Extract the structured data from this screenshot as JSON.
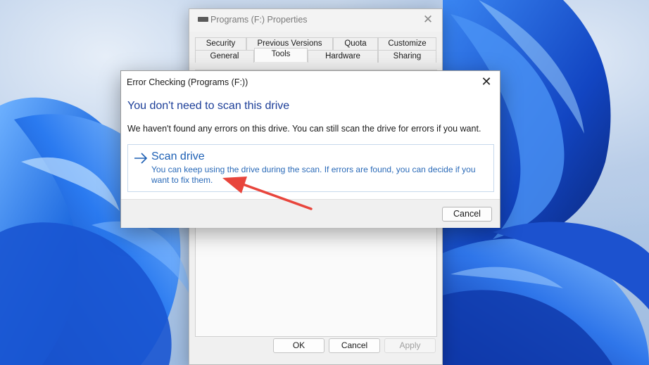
{
  "properties_window": {
    "title": "Programs (F:) Properties",
    "close_glyph": "✕",
    "tabs_row1": [
      "Security",
      "Previous Versions",
      "Quota",
      "Customize"
    ],
    "tabs_row2": [
      "General",
      "Tools",
      "Hardware",
      "Sharing"
    ],
    "active_tab": "Tools",
    "buttons": {
      "ok": "OK",
      "cancel": "Cancel",
      "apply": "Apply"
    },
    "icon": "drive-icon"
  },
  "error_dialog": {
    "title": "Error Checking (Programs (F:))",
    "close_glyph": "✕",
    "heading": "You don't need to scan this drive",
    "message": "We haven't found any errors on this drive. You can still scan the drive for errors if you want.",
    "scan_option": {
      "icon": "arrow-right-icon",
      "title": "Scan drive",
      "description": "You can keep using the drive during the scan. If errors are found, you can decide if you want to fix them."
    },
    "cancel_label": "Cancel"
  },
  "annotation": {
    "color": "#e8453c",
    "icon": "annotation-arrow"
  },
  "colors": {
    "heading_blue": "#1c3e98",
    "link_blue": "#1c5fb4",
    "wallpaper_blue": "#1e5fd6"
  }
}
